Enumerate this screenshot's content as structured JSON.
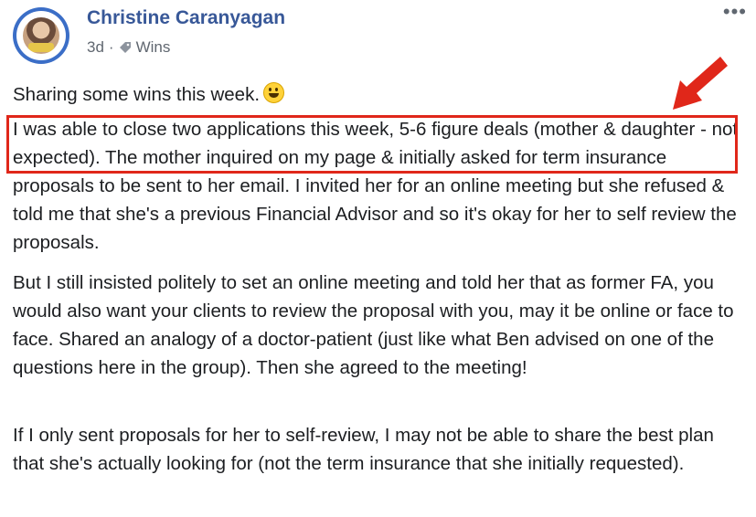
{
  "post": {
    "author": "Christine Caranyagan",
    "time": "3d",
    "separator": "·",
    "topic": "Wins",
    "icons": {
      "more": "more-options-icon",
      "topic": "tag-icon",
      "emoji": "grinning-face-icon",
      "annotation": "red-arrow-icon"
    },
    "accent_color": "#385898",
    "highlight_color": "#e0271a",
    "more_label": "•••",
    "body": {
      "intro": "Sharing some wins this week.",
      "para1": "I was able to close two applications this week, 5-6 figure deals (mother & daughter - not expected). The mother inquired on my page & initially asked for term insurance proposals to be sent to her email. I invited her for an online meeting but she refused & told me that she's a previous Financial Advisor and so it's okay for her to self review the proposals.",
      "para2": "But I still insisted politely to set an online meeting and told her that as former FA, you would also want your clients to review the proposal with you, may it be online or face to face. Shared an analogy of a doctor-patient (just like what Ben advised on one of the questions here in the group). Then she agreed to the meeting!",
      "para3": "If I only sent proposals for her to self-review, I may not be able to share the best plan that she's actually looking for (not the term insurance that she initially requested)."
    }
  }
}
